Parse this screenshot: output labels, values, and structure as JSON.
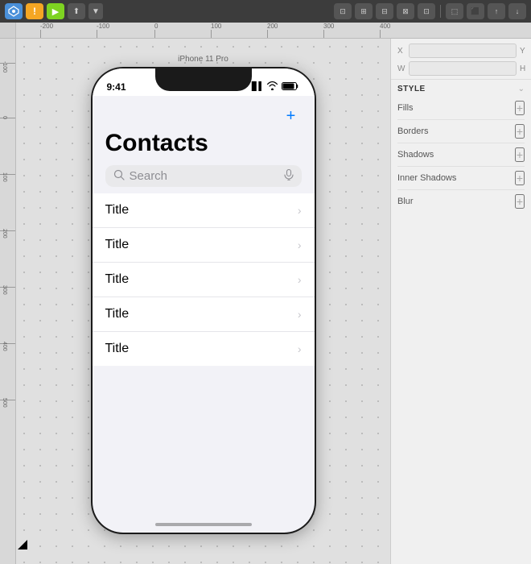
{
  "toolbar": {
    "buttons": [
      {
        "id": "sketch-icon",
        "label": "S",
        "type": "blue"
      },
      {
        "id": "alert-icon",
        "label": "!",
        "type": "orange"
      },
      {
        "id": "play-icon",
        "label": "▶",
        "type": "green"
      },
      {
        "id": "share-icon",
        "label": "⬆",
        "type": "normal"
      },
      {
        "id": "dropdown-icon",
        "label": "▼",
        "type": "dropdown"
      }
    ],
    "right_buttons": [
      {
        "id": "align-left",
        "label": "⊡"
      },
      {
        "id": "align-center",
        "label": "⊞"
      },
      {
        "id": "align-right",
        "label": "⊟"
      },
      {
        "id": "dist-h",
        "label": "⊠"
      },
      {
        "id": "dist-v",
        "label": "⊡"
      },
      {
        "id": "sep",
        "label": "|"
      },
      {
        "id": "group",
        "label": "⬚"
      },
      {
        "id": "ungroup",
        "label": "⬛"
      },
      {
        "id": "forward",
        "label": "↑"
      },
      {
        "id": "backward",
        "label": "↓"
      }
    ]
  },
  "ruler": {
    "ticks": [
      "-200",
      "-100",
      "0",
      "100",
      "200",
      "300",
      "400"
    ]
  },
  "right_panel": {
    "coords": {
      "x_label": "X",
      "y_label": "Y",
      "w_label": "W",
      "h_label": "H",
      "x_value": "",
      "y_value": "",
      "w_value": "",
      "h_value": ""
    },
    "style_section": {
      "title": "STYLE",
      "expand_label": "⌄"
    },
    "style_rows": [
      {
        "id": "fills",
        "label": "Fills",
        "action": "+"
      },
      {
        "id": "borders",
        "label": "Borders",
        "action": "+"
      },
      {
        "id": "shadows",
        "label": "Shadows",
        "action": "+"
      },
      {
        "id": "inner-shadows",
        "label": "Inner Shadows",
        "action": "+"
      },
      {
        "id": "blur",
        "label": "Blur",
        "action": "+"
      }
    ]
  },
  "canvas": {
    "phone_label": "iPhone 11 Pro",
    "status_time": "9:41",
    "status_signal": "▐▌▌",
    "status_wifi": "wifi",
    "status_battery": "🔋",
    "contacts_title": "Contacts",
    "search_placeholder": "Search",
    "add_button": "+",
    "contact_items": [
      {
        "title": "Title"
      },
      {
        "title": "Title"
      },
      {
        "title": "Title"
      },
      {
        "title": "Title"
      },
      {
        "title": "Title"
      }
    ]
  }
}
